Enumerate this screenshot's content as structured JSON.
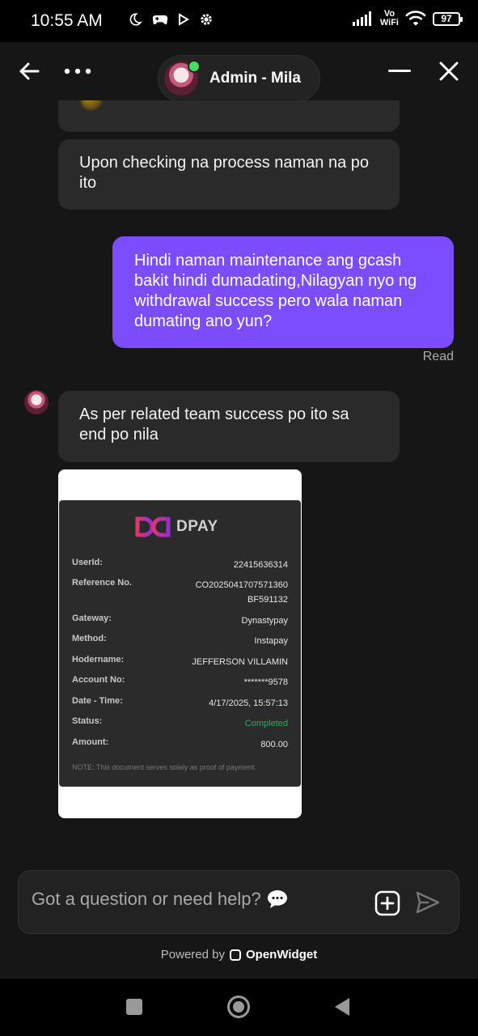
{
  "status_bar": {
    "time": "10:55 AM",
    "network": "Vo\nWiFi",
    "battery": "97"
  },
  "header": {
    "agent_name": "Admin - Mila"
  },
  "messages": [
    {
      "id": "m1",
      "from": "agent",
      "text": "Upon checking na process naman na po ito"
    },
    {
      "id": "m2",
      "from": "user",
      "text": "Hindi naman maintenance ang gcash bakit hindi dumadating,Nilagyan nyo ng withdrawal success pero wala naman dumating ano yun?"
    },
    {
      "id": "m3",
      "from": "agent",
      "text": "As per related team success po ito sa end po nila"
    }
  ],
  "read_receipt": "Read",
  "receipt": {
    "brand": "DPAY",
    "rows": [
      {
        "label": "UserId:",
        "value": "22415636314"
      },
      {
        "label": "Reference No.",
        "value": "CO2025041707571360 BF591132"
      },
      {
        "label": "Gateway:",
        "value": "Dynastypay"
      },
      {
        "label": "Method:",
        "value": "Instapay"
      },
      {
        "label": "Hodername:",
        "value": "JEFFERSON VILLAMIN"
      },
      {
        "label": "Account No:",
        "value": "*******9578"
      },
      {
        "label": "Date - Time:",
        "value": "4/17/2025, 15:57:13"
      },
      {
        "label": "Status:",
        "value": "Completed"
      },
      {
        "label": "Amount:",
        "value": "800.00"
      }
    ],
    "note": "NOTE: This document serves solely as proof of payment."
  },
  "composer": {
    "placeholder": "Got a question or need help?"
  },
  "footer": {
    "powered_by": "Powered by",
    "brand": "OpenWidget"
  },
  "colors": {
    "accent": "#7b4dff",
    "bubble_in": "#2a2a2a",
    "background": "#161616",
    "status_completed": "#27ae60"
  }
}
